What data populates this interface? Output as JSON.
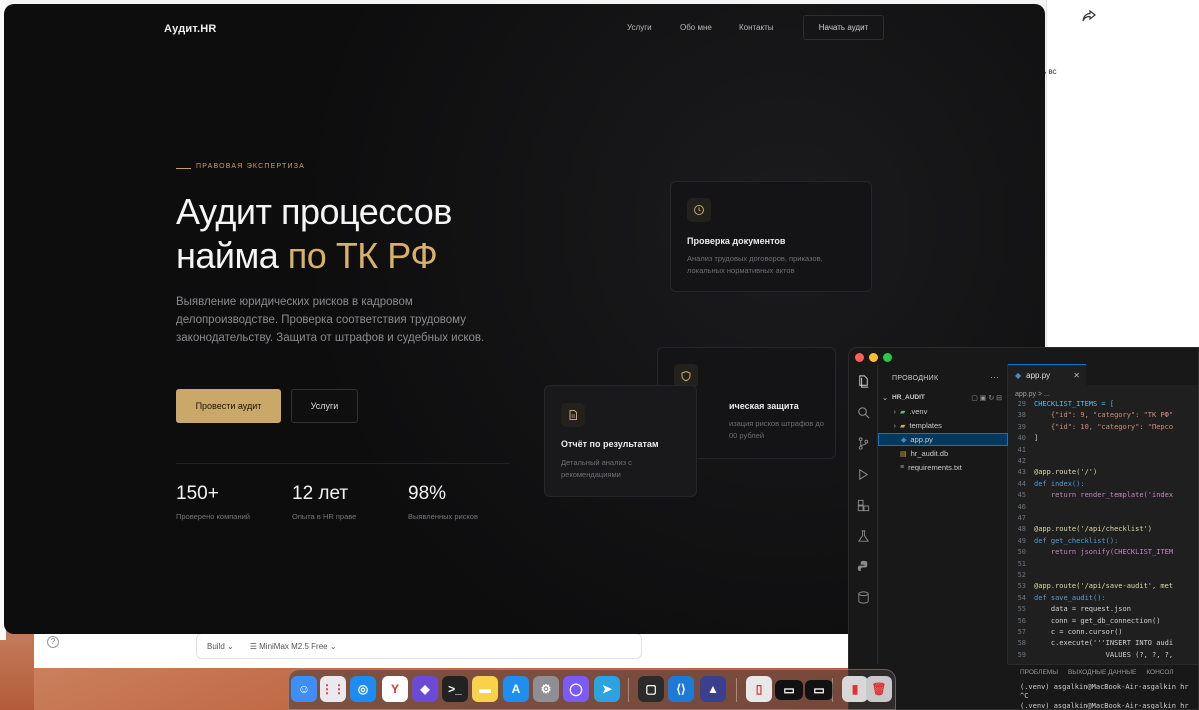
{
  "bg_window": {
    "right_snippet": "ь вс",
    "bottom_bar": {
      "build_label": "Build",
      "model_label": "MiniMax M2.5 Free",
      "help": "?"
    }
  },
  "site": {
    "logo": "Аудит.HR",
    "nav": [
      "Услуги",
      "Обо мне",
      "Контакты"
    ],
    "nav_cta": "Начать аудит",
    "eyebrow": "ПРАВОВАЯ ЭКСПЕРТИЗА",
    "title_line1": "Аудит процессов",
    "title_line2_plain": "найма ",
    "title_line2_accent": "по ТК РФ",
    "description": "Выявление юридических рисков в кадровом делопроизводстве. Проверка соответствия трудовому законодательству. Защита от штрафов и судебных исков.",
    "primary_button": "Провести аудит",
    "secondary_button": "Услуги",
    "stats": [
      {
        "value": "150+",
        "label": "Проверено компаний"
      },
      {
        "value": "12 лет",
        "label": "Опыта в HR праве"
      },
      {
        "value": "98%",
        "label": "Выявленных рисков"
      }
    ],
    "cards": [
      {
        "title": "Проверка документов",
        "desc": "Анализ трудовых договоров, приказов, локальных нормативных актов",
        "icon": "clock-icon"
      },
      {
        "title": "ическая защита",
        "desc": "изация рисков штрафов до 00 рублей",
        "icon": "shield-icon"
      },
      {
        "title": "Отчёт по результатам",
        "desc": "Детальный анализ с рекомендациями",
        "icon": "document-icon"
      }
    ],
    "colors": {
      "accent": "#c9a869",
      "background": "#0d0d0e"
    }
  },
  "vscode": {
    "explorer_title": "ПРОВОДНИК",
    "project": "HR_AUDIT",
    "tree": [
      {
        "name": ".venv",
        "type": "folder"
      },
      {
        "name": "templates",
        "type": "folder"
      },
      {
        "name": "app.py",
        "type": "python",
        "selected": true
      },
      {
        "name": "hr_audit.db",
        "type": "db"
      },
      {
        "name": "requirements.txt",
        "type": "text"
      }
    ],
    "tab": "app.py",
    "breadcrumb": "app.py > ...",
    "code": [
      {
        "ln": "29",
        "text": "CHECKLIST_ITEMS = ["
      },
      {
        "ln": "38",
        "text": "    {\"id\": 9, \"category\": \"ТК РФ\""
      },
      {
        "ln": "39",
        "text": "    {\"id\": 10, \"category\": \"Персо"
      },
      {
        "ln": "40",
        "text": "]"
      },
      {
        "ln": "41",
        "text": ""
      },
      {
        "ln": "42",
        "text": ""
      },
      {
        "ln": "43",
        "text": "@app.route('/')"
      },
      {
        "ln": "44",
        "text": "def index():"
      },
      {
        "ln": "45",
        "text": "    return render_template('index"
      },
      {
        "ln": "46",
        "text": ""
      },
      {
        "ln": "47",
        "text": ""
      },
      {
        "ln": "48",
        "text": "@app.route('/api/checklist')"
      },
      {
        "ln": "49",
        "text": "def get_checklist():"
      },
      {
        "ln": "50",
        "text": "    return jsonify(CHECKLIST_ITEM"
      },
      {
        "ln": "51",
        "text": ""
      },
      {
        "ln": "52",
        "text": ""
      },
      {
        "ln": "53",
        "text": "@app.route('/api/save-audit', met"
      },
      {
        "ln": "54",
        "text": "def save_audit():"
      },
      {
        "ln": "55",
        "text": "    data = request.json"
      },
      {
        "ln": "56",
        "text": "    conn = get_db_connection()"
      },
      {
        "ln": "57",
        "text": "    c = conn.cursor()"
      },
      {
        "ln": "58",
        "text": "    c.execute('''INSERT INTO audi"
      },
      {
        "ln": "59",
        "text": "                 VALUES (?, ?, ?,"
      }
    ],
    "panel_tabs": [
      "ПРОБЛЕМЫ",
      "ВЫХОДНЫЕ ДАННЫЕ",
      "КОНСОЛ"
    ],
    "terminal": [
      "(.venv) asgalkin@MacBook-Air-asgalkin hr",
      "^C",
      "(.venv) asgalkin@MacBook-Air-asgalkin hr"
    ]
  },
  "dock": {
    "apps": [
      "finder",
      "launchpad",
      "safari",
      "yandex-browser",
      "obsidian",
      "terminal",
      "notes",
      "app-store",
      "settings",
      "chat",
      "telegram",
      "stage",
      "vscode",
      "mimestream",
      "preview",
      "window-1",
      "window-2",
      "archive",
      "trash"
    ]
  }
}
